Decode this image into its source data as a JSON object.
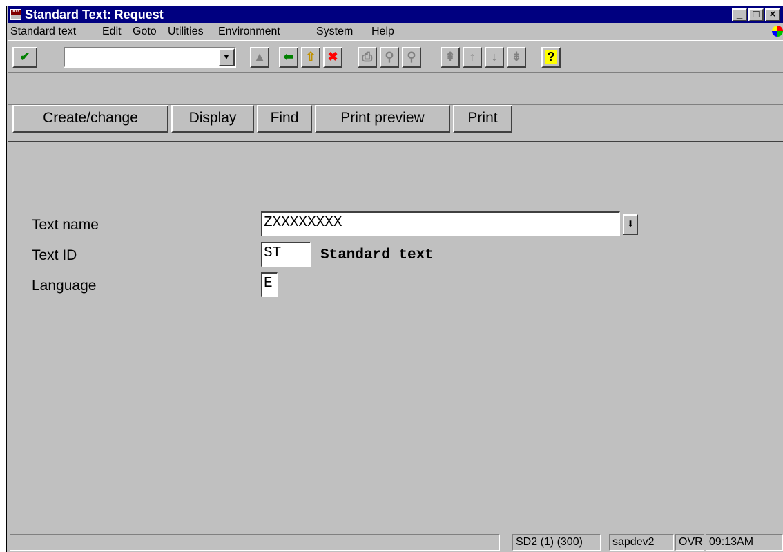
{
  "window": {
    "title": "Standard Text: Request",
    "app_icon_text": "R/3",
    "controls": {
      "minimize": "_",
      "maximize": "□",
      "close": "×"
    }
  },
  "menu": {
    "items": [
      "Standard text",
      "Edit",
      "Goto",
      "Utilities",
      "Environment",
      "System",
      "Help"
    ]
  },
  "toolbar": {
    "command_field_value": "",
    "icons": {
      "enter": "checkmark-icon",
      "save": "save-icon",
      "back": "back-arrow-icon",
      "exit": "exit-up-icon",
      "cancel": "cancel-x-icon",
      "print": "print-icon",
      "find": "find-icon",
      "find_next": "find-next-icon",
      "first_page": "first-page-icon",
      "prev_page": "previous-page-icon",
      "next_page": "next-page-icon",
      "last_page": "last-page-icon",
      "help": "help-icon"
    }
  },
  "app_toolbar": {
    "buttons": [
      "Create/change",
      "Display",
      "Find",
      "Print preview",
      "Print"
    ]
  },
  "form": {
    "text_name": {
      "label": "Text name",
      "value": "ZXXXXXXXX"
    },
    "text_id": {
      "label": "Text ID",
      "value": "ST",
      "description": "Standard text"
    },
    "language": {
      "label": "Language",
      "value": "E"
    }
  },
  "statusbar": {
    "message": "",
    "system": "SD2 (1) (300)",
    "server": "sapdev2",
    "mode": "OVR",
    "time": "09:13AM"
  },
  "colors": {
    "titlebar": "#000080",
    "background": "#c0c0c0",
    "enter_check": "#008000",
    "back_arrow": "#008000",
    "exit_arrow": "#c0a000",
    "cancel_x": "#ff0000",
    "help": "#ffff00"
  }
}
